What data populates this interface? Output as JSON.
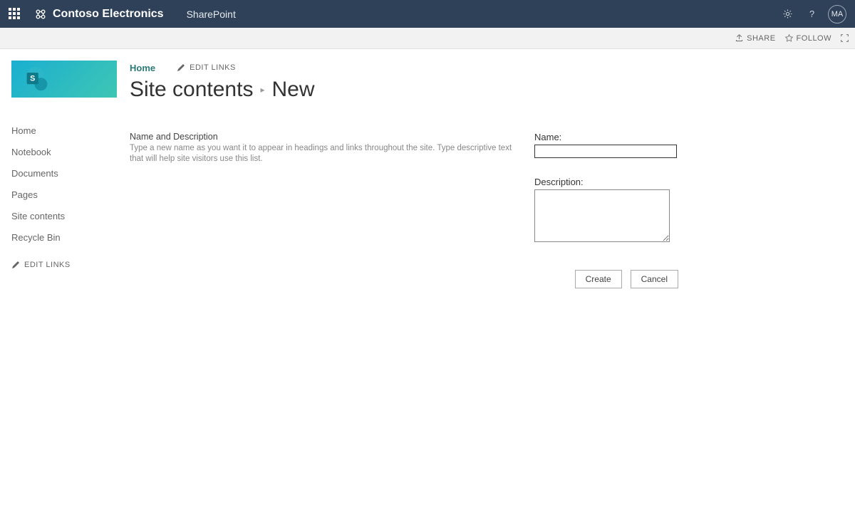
{
  "topbar": {
    "org": "Contoso Electronics",
    "app": "SharePoint",
    "avatar": "MA"
  },
  "ribbon": {
    "share": "SHARE",
    "follow": "FOLLOW"
  },
  "sidebar": {
    "items": [
      {
        "label": "Home"
      },
      {
        "label": "Notebook"
      },
      {
        "label": "Documents"
      },
      {
        "label": "Pages"
      },
      {
        "label": "Site contents"
      },
      {
        "label": "Recycle Bin"
      }
    ],
    "edit_links": "EDIT LINKS"
  },
  "topnav": {
    "home": "Home",
    "edit_links": "EDIT LINKS"
  },
  "title": {
    "breadcrumb": "Site contents",
    "current": "New"
  },
  "form": {
    "section_title": "Name and Description",
    "section_help": "Type a new name as you want it to appear in headings and links throughout the site. Type descriptive text that will help site visitors use this list.",
    "name_label": "Name:",
    "name_value": "",
    "desc_label": "Description:",
    "desc_value": "",
    "create": "Create",
    "cancel": "Cancel"
  }
}
